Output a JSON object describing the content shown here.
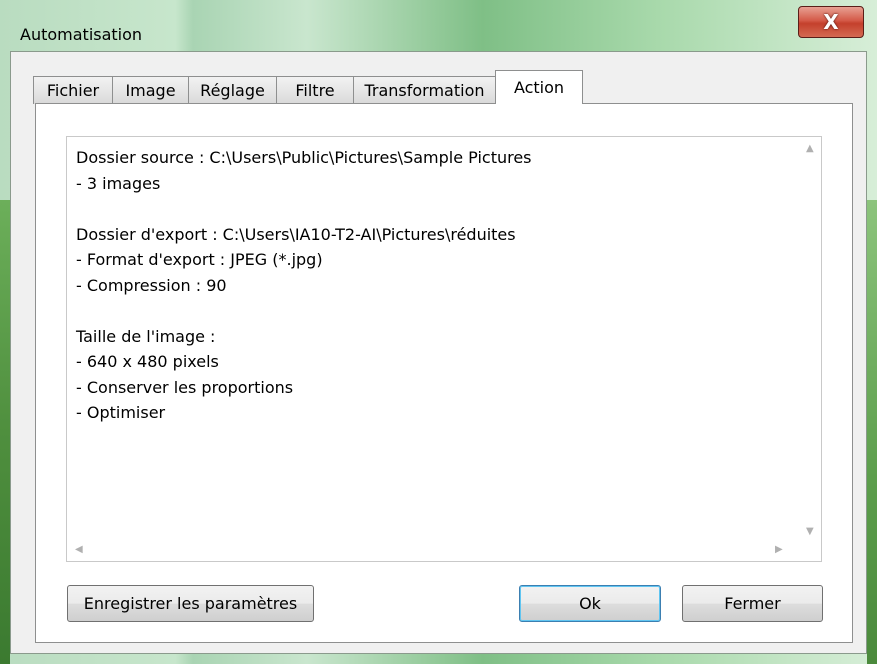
{
  "window": {
    "title": "Automatisation",
    "close_glyph": "X"
  },
  "tabs": [
    {
      "label": "Fichier"
    },
    {
      "label": "Image"
    },
    {
      "label": "Réglage"
    },
    {
      "label": "Filtre"
    },
    {
      "label": "Transformation"
    },
    {
      "label": "Action"
    }
  ],
  "active_tab": "Action",
  "summary": {
    "lines": [
      "Dossier source : C:\\Users\\Public\\Pictures\\Sample Pictures",
      "- 3 images",
      "",
      "Dossier d'export : C:\\Users\\IA10-T2-AI\\Pictures\\réduites",
      "- Format d'export : JPEG (*.jpg)",
      "- Compression : 90",
      "",
      "Taille de l'image :",
      "- 640 x 480 pixels",
      "- Conserver les proportions",
      "- Optimiser"
    ]
  },
  "buttons": {
    "save_settings": "Enregistrer les paramètres",
    "ok": "Ok",
    "close": "Fermer"
  },
  "colors": {
    "close_button": "#c4402c",
    "default_button_border": "#3c7fb1"
  }
}
